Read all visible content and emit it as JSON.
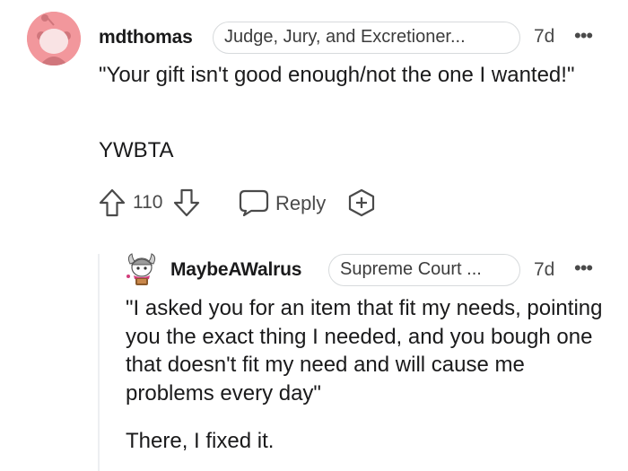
{
  "comment": {
    "username": "mdthomas",
    "flair": "Judge, Jury, and Excretioner...",
    "time": "7d",
    "more": "•••",
    "body_quote": "\"Your gift isn't good enough/not the one I wanted!\"",
    "body_verdict": "YWBTA",
    "votes": "110",
    "reply_label": "Reply"
  },
  "reply": {
    "username": "MaybeAWalrus",
    "flair": "Supreme Court ...",
    "time": "7d",
    "more": "•••",
    "body_quote": "\"I asked you for an item that fit my needs, pointing you the exact thing I needed, and you bough one that doesn't fit my need and will cause me problems every day\"",
    "body_closing": "There, I fixed it."
  },
  "colors": {
    "avatar_bg": "#f2979c",
    "text": "#1a1a1b",
    "meta": "#4a4a4a",
    "flair_border": "#d7dadc",
    "thread_line": "#edeff1"
  },
  "icons": [
    "default-avatar-icon",
    "upvote-icon",
    "downvote-icon",
    "reply-bubble-icon",
    "award-plus-icon",
    "more-options-icon",
    "user-avatar-icon"
  ]
}
